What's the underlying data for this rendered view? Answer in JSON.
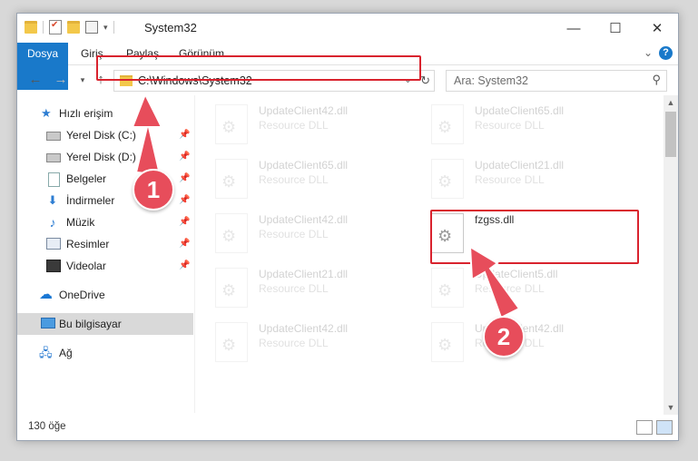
{
  "window": {
    "title": "System32",
    "controls": [
      "minimize-icon",
      "maximize-icon",
      "close-icon"
    ]
  },
  "ribbon": {
    "tabs": [
      "Dosya",
      "Giriş",
      "Paylaş",
      "Görünüm"
    ]
  },
  "address": {
    "path": "C:\\Windows\\System32"
  },
  "search": {
    "placeholder": "Ara: System32"
  },
  "sidebar": {
    "items": [
      {
        "label": "Hızlı erişim",
        "icon": "star-icon",
        "pinned": false
      },
      {
        "label": "Yerel Disk (C:)",
        "icon": "drive-icon",
        "pinned": true
      },
      {
        "label": "Yerel Disk (D:)",
        "icon": "drive-icon",
        "pinned": true
      },
      {
        "label": "Belgeler",
        "icon": "documents-icon",
        "pinned": true
      },
      {
        "label": "İndirmeler",
        "icon": "downloads-icon",
        "pinned": true
      },
      {
        "label": "Müzik",
        "icon": "music-icon",
        "pinned": true
      },
      {
        "label": "Resimler",
        "icon": "pictures-icon",
        "pinned": true
      },
      {
        "label": "Videolar",
        "icon": "videos-icon",
        "pinned": true
      },
      {
        "label": "OneDrive",
        "icon": "cloud-icon",
        "pinned": false
      },
      {
        "label": "Bu bilgisayar",
        "icon": "computer-icon",
        "pinned": false,
        "selected": true
      },
      {
        "label": "Ağ",
        "icon": "network-icon",
        "pinned": false
      }
    ]
  },
  "files": [
    {
      "name": "UpdateClient42.dll",
      "type": "Resource DLL",
      "faded": true
    },
    {
      "name": "UpdateClient65.dll",
      "type": "Resource DLL",
      "faded": true
    },
    {
      "name": "UpdateClient65.dll",
      "type": "Resource DLL",
      "faded": true
    },
    {
      "name": "UpdateClient21.dll",
      "type": "Resource DLL",
      "faded": true
    },
    {
      "name": "UpdateClient42.dll",
      "type": "Resource DLL",
      "faded": true
    },
    {
      "name": "fzgss.dll",
      "type": "",
      "faded": false
    },
    {
      "name": "UpdateClient21.dll",
      "type": "Resource DLL",
      "faded": true
    },
    {
      "name": "UpdateClient5.dll",
      "type": "Resource DLL",
      "faded": true
    },
    {
      "name": "UpdateClient42.dll",
      "type": "Resource DLL",
      "faded": true
    },
    {
      "name": "UpdateClient42.dll",
      "type": "Resource DLL",
      "faded": true
    }
  ],
  "status": {
    "count": "130 öğe"
  },
  "annotations": {
    "step1": "1",
    "step2": "2",
    "color": "#d9232e"
  }
}
